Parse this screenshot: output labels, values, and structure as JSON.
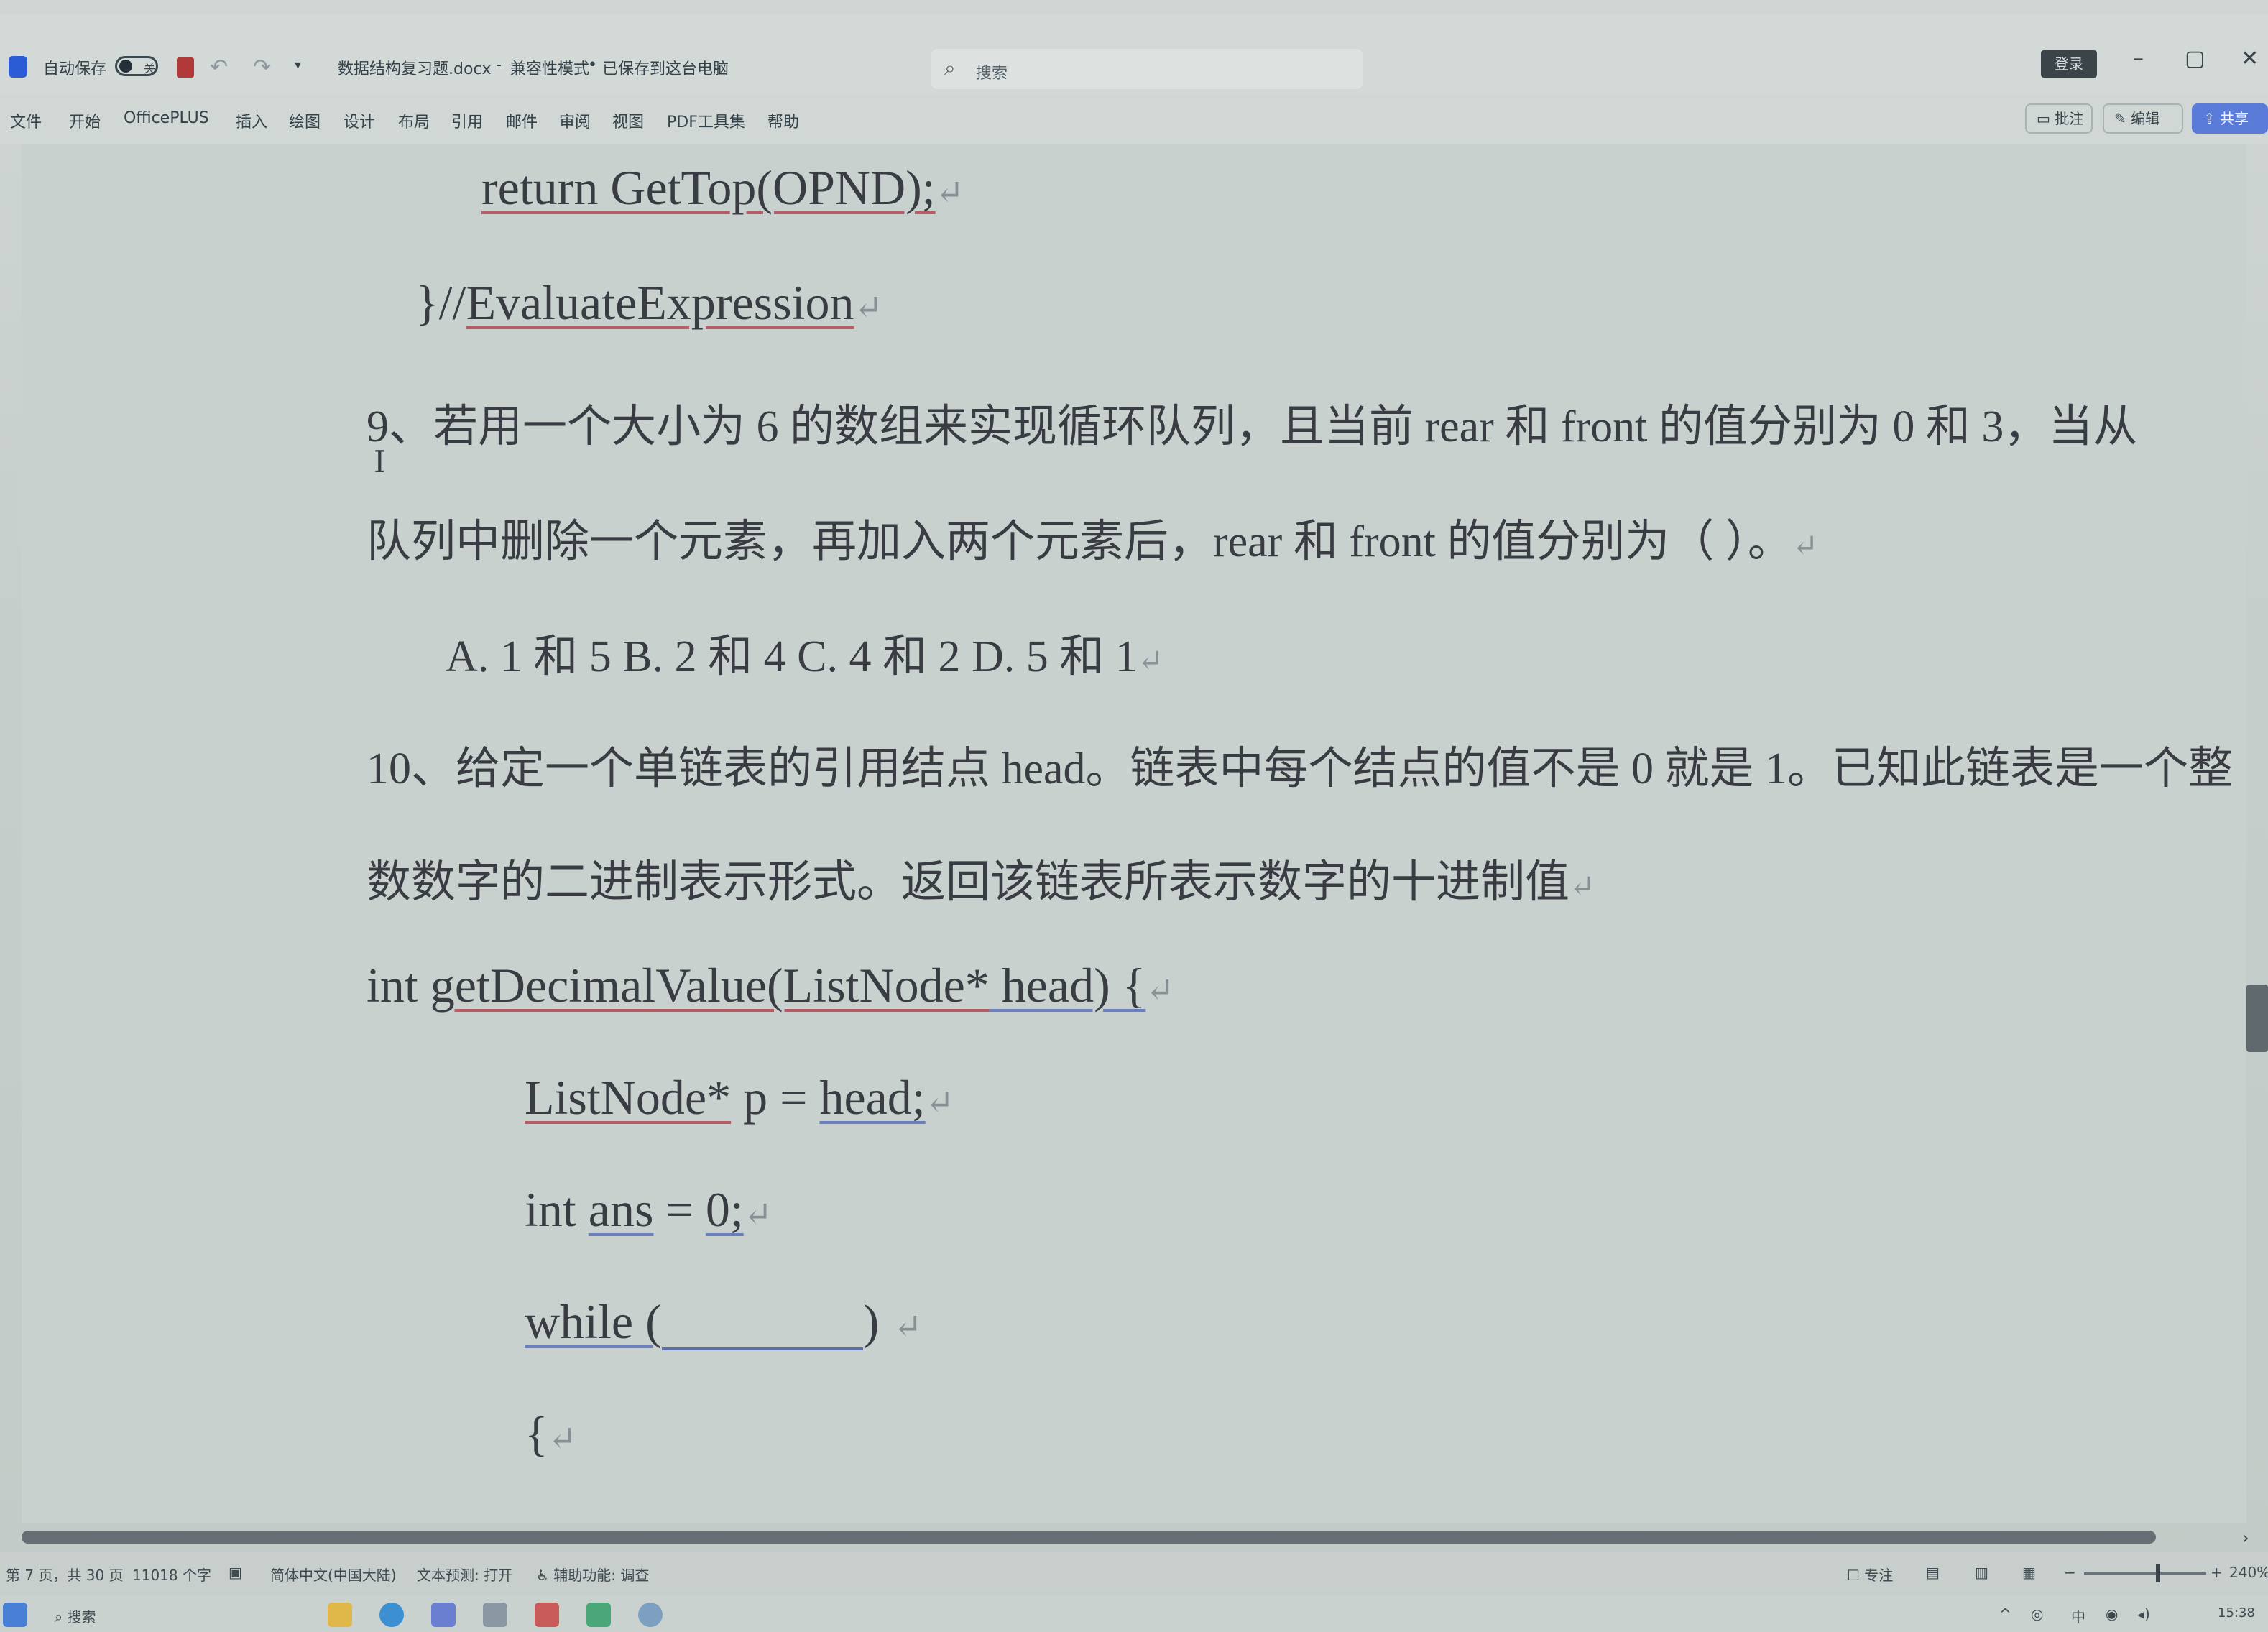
{
  "titlebar": {
    "autosave_label": "自动保存",
    "toggle_state": "关",
    "filename": "数据结构复习题.docx",
    "mode": "兼容性模式",
    "save_status": "已保存到这台电脑",
    "search_placeholder": "搜索",
    "window_badge": "登录",
    "minimize": "–",
    "restore": "▢",
    "close": "✕"
  },
  "menu": {
    "items": [
      "文件",
      "开始",
      "OfficePLUS",
      "插入",
      "绘图",
      "设计",
      "布局",
      "引用",
      "邮件",
      "审阅",
      "视图",
      "PDF工具集",
      "帮助"
    ],
    "comments_label": "批注",
    "editing_label": "编辑",
    "share_label": "共享"
  },
  "document": {
    "l1": "return GetTop(OPND);",
    "l2a": "}//",
    "l2b": "EvaluateExpression",
    "q9_line1": "9、若用一个大小为 6 的数组来实现循环队列，且当前 rear 和 front 的值分别为 0 和 3，当从",
    "q9_line2": "队列中删除一个元素，再加入两个元素后，rear 和 front 的值分别为（     ）。",
    "q9_options": "A.  1 和 5      B.  2 和 4      C.  4 和 2      D.  5 和 1",
    "q10_line1": "10、给定一个单链表的引用结点 head。链表中每个结点的值不是 0 就是 1。已知此链表是一个整",
    "q10_line2": "数数字的二进制表示形式。返回该链表所表示数字的十进制值",
    "code_sig_a": "int ",
    "code_sig_b": "getDecimalValue(ListNode*",
    "code_sig_c": " head) {",
    "code_p_a": "ListNode*",
    "code_p_b": " p = ",
    "code_p_c": "head;",
    "code_ans_a": "int ",
    "code_ans_b": "ans",
    "code_ans_c": " = ",
    "code_ans_d": "0;",
    "code_while": "while (",
    "code_while_end": ")",
    "code_brace": "{",
    "para_mark": "↵"
  },
  "status": {
    "page": "第 7 页，共 30 页",
    "words": "11018 个字",
    "language": "简体中文(中国大陆)",
    "prediction": "文本预测: 打开",
    "accessibility": "辅助功能: 调查",
    "focus": "专注",
    "zoom": "240%"
  },
  "taskbar": {
    "search": "搜索",
    "ime": "中",
    "clock": "15:38"
  }
}
